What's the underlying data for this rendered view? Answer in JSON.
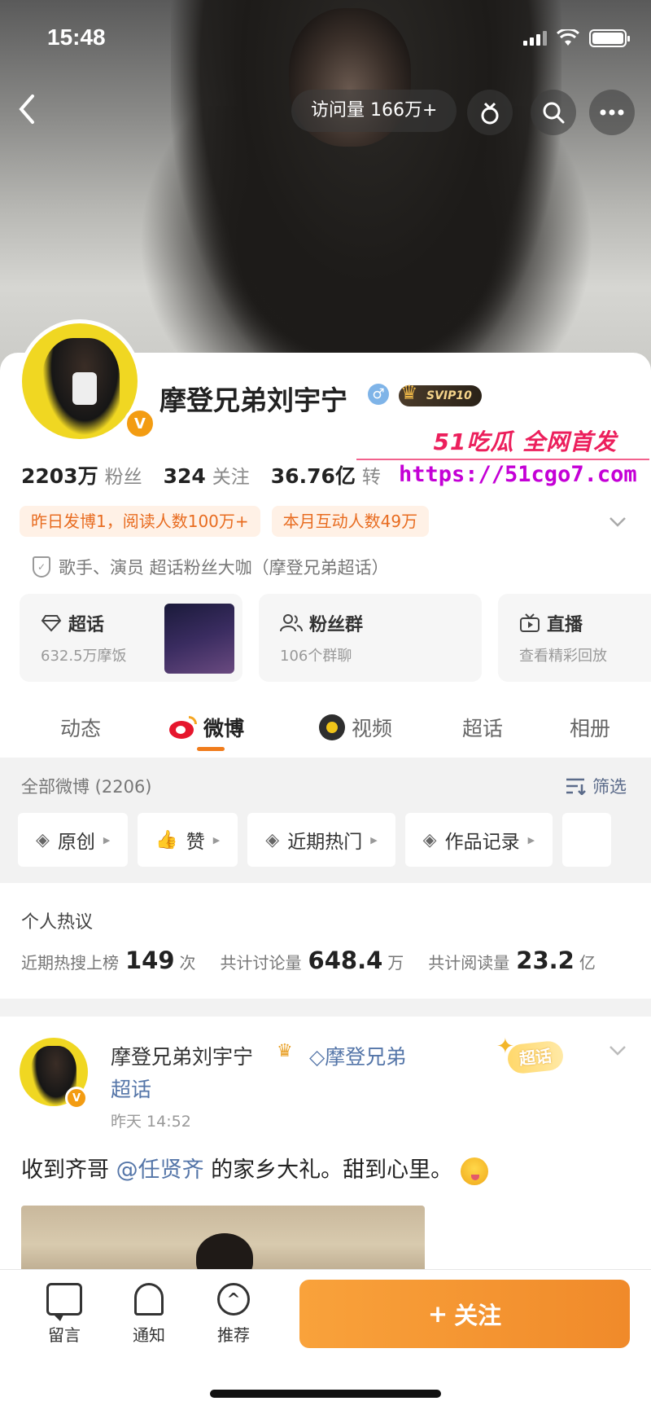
{
  "status": {
    "time": "15:48"
  },
  "nav": {
    "back_icon": "back-arrow-icon",
    "visits": "访问量 166万+"
  },
  "profile": {
    "name": "摩登兄弟刘宇宁",
    "gender_symbol": "♂",
    "vip_label": "SVIP10",
    "badge_v": "V",
    "stats": {
      "fans_num": "2203万",
      "fans_label": "粉丝",
      "follow_num": "324",
      "follow_label": "关注",
      "like_num": "36.76亿",
      "like_label": "转"
    },
    "tags": [
      "昨日发博1，阅读人数100万+",
      "本月互动人数49万"
    ],
    "verified_text": "歌手、演员 超话粉丝大咖（摩登兄弟超话）",
    "cards": [
      {
        "title": "超话",
        "sub": "632.5万摩饭"
      },
      {
        "title": "粉丝群",
        "sub": "106个群聊"
      },
      {
        "title": "直播",
        "sub": "查看精彩回放"
      }
    ]
  },
  "watermark": {
    "line1": "51吃瓜 全网首发",
    "line2": "https://51cgo7.com"
  },
  "tabs": [
    "动态",
    "微博",
    "视频",
    "超话",
    "相册"
  ],
  "feed_filter": {
    "count_label": "全部微博 (2206)",
    "filter_label": "筛选",
    "chips": [
      "原创",
      "赞",
      "近期热门",
      "作品记录"
    ]
  },
  "hot": {
    "title": "个人热议",
    "items": [
      {
        "label": "近期热搜上榜",
        "value": "149",
        "unit": "次"
      },
      {
        "label": "共计讨论量",
        "value": "648.4",
        "unit": "万"
      },
      {
        "label": "共计阅读量",
        "value": "23.2",
        "unit": "亿"
      }
    ]
  },
  "post": {
    "author": "摩登兄弟刘宇宁",
    "topic_line1": "摩登兄弟",
    "topic_line2": "超话",
    "time": "昨天 14:52",
    "chaohua_badge": "超话",
    "text_before": "收到齐哥",
    "mention": "@任贤齐",
    "text_after": " 的家乡大礼。甜到心里。"
  },
  "bottom": {
    "message": "留言",
    "notify": "通知",
    "recommend": "推荐",
    "follow": "关注",
    "follow_plus": "+"
  },
  "colors": {
    "accent": "#f08a2a",
    "link": "#5475a8",
    "tag_text": "#e86c20"
  }
}
